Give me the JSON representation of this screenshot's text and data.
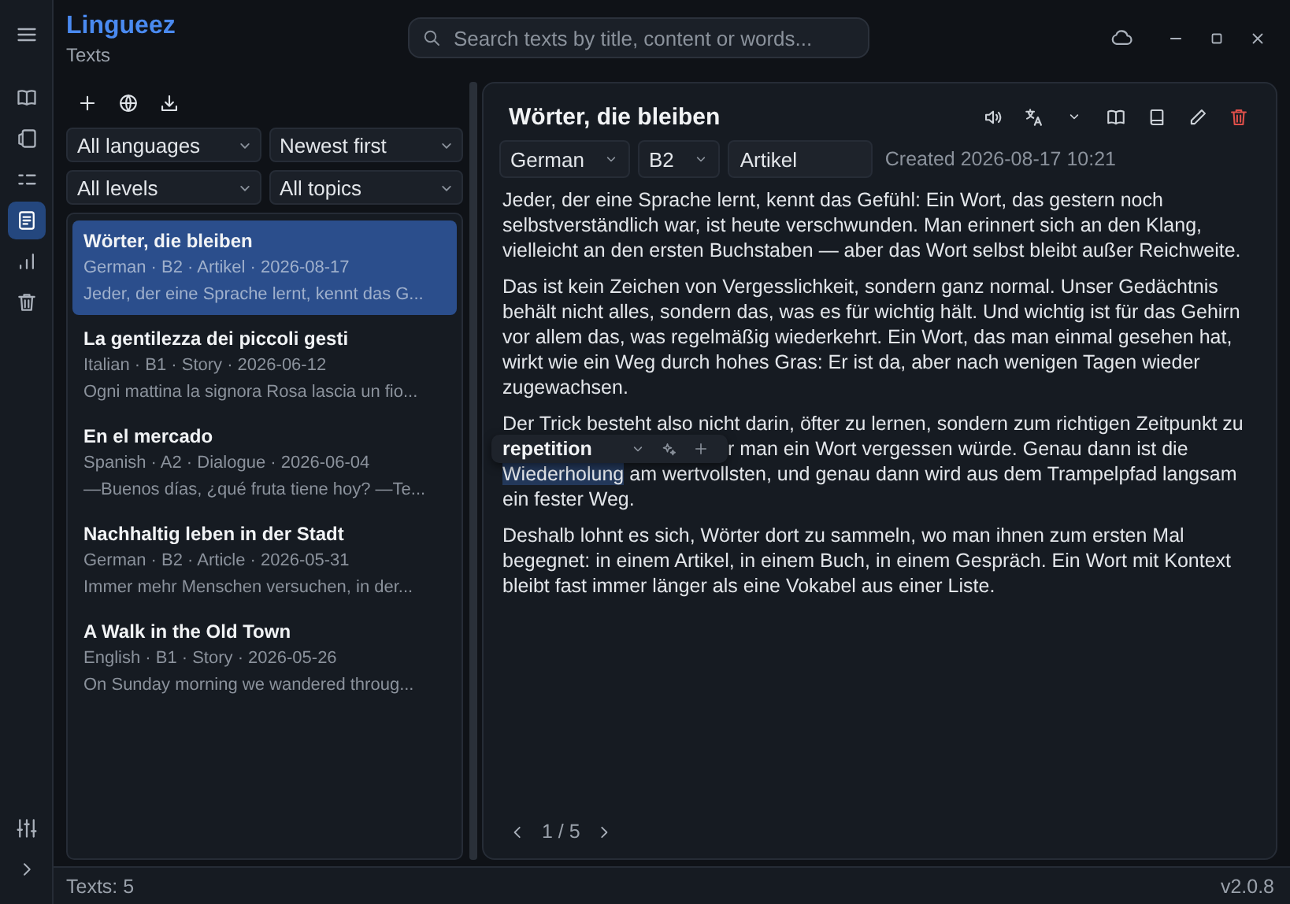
{
  "app": {
    "name": "Lingueez",
    "section": "Texts"
  },
  "search": {
    "placeholder": "Search texts by title, content or words..."
  },
  "rail": {
    "items": [
      {
        "kind": "book",
        "selected": false
      },
      {
        "kind": "cards",
        "selected": false
      },
      {
        "kind": "checklist",
        "selected": false
      },
      {
        "kind": "document",
        "selected": true
      },
      {
        "kind": "chart",
        "selected": false
      },
      {
        "kind": "trash",
        "selected": false
      }
    ]
  },
  "filters": [
    "All languages",
    "Newest first",
    "All levels",
    "All topics"
  ],
  "texts": [
    {
      "title": "Wörter, die bleiben",
      "meta": "German · B2 · Artikel · 2026-08-17",
      "preview": "Jeder, der eine Sprache lernt, kennt das G...",
      "selected": true
    },
    {
      "title": "La gentilezza dei piccoli gesti",
      "meta": "Italian · B1 · Story · 2026-06-12",
      "preview": "Ogni mattina la signora Rosa lascia un fio...",
      "selected": false
    },
    {
      "title": "En el mercado",
      "meta": "Spanish · A2 · Dialogue · 2026-06-04",
      "preview": "—Buenos días, ¿qué fruta tiene hoy? —Te...",
      "selected": false
    },
    {
      "title": "Nachhaltig leben in der Stadt",
      "meta": "German · B2 · Article · 2026-05-31",
      "preview": "Immer mehr Menschen versuchen, in der...",
      "selected": false
    },
    {
      "title": "A Walk in the Old Town",
      "meta": "English · B1 · Story · 2026-05-26",
      "preview": "On Sunday morning we wandered throug...",
      "selected": false
    }
  ],
  "reader": {
    "title": "Wörter, die bleiben",
    "language": "German",
    "level": "B2",
    "topic": "Artikel",
    "created": "Created 2026-08-17 10:21",
    "paragraphs": [
      {
        "kind": "plain",
        "text": "Jeder, der eine Sprache lernt, kennt das Gefühl: Ein Wort, das gestern noch selbstverständlich war, ist heute verschwunden. Man erinnert sich an den Klang, vielleicht an den ersten Buchstaben — aber das Wort selbst bleibt außer Reichweite."
      },
      {
        "kind": "plain",
        "text": "Das ist kein Zeichen von Vergesslichkeit, sondern ganz normal. Unser Gedächtnis behält nicht alles, sondern das, was es für wichtig hält. Und wichtig ist für das Gehirn vor allem das, was regelmäßig wiederkehrt. Ein Wort, das man einmal gesehen hat, wirkt wie ein Weg durch hohes Gras: Er ist da, aber nach wenigen Tagen wieder zugewachsen."
      },
      {
        "kind": "overlaid",
        "line_1": "Der Trick besteht also nicht darin, öfter zu lernen, sondern zum richtigen Zeitpunkt zu",
        "partial": "r man ein Wort vergessen würde. Genau dann ist die",
        "highlight": "Wiederholung",
        "rest": " am wertvollsten, und genau dann wird aus dem Trampelpfad langsam ein fester Weg."
      },
      {
        "kind": "plain",
        "text": "Deshalb lohnt es sich, Wörter dort zu sammeln, wo man ihnen zum ersten Mal begegnet: in einem Artikel, in einem Buch, in einem Gespräch. Ein Wort mit Kontext bleibt fast immer länger als eine Vokabel aus einer Liste."
      }
    ],
    "popup": {
      "word": "repetition"
    },
    "pager": "1 / 5"
  },
  "status": {
    "count": "Texts: 5",
    "version": "v2.0.8"
  }
}
